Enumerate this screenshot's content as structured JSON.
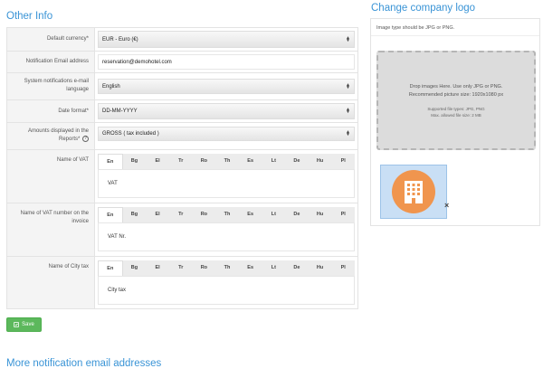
{
  "other_info": {
    "title": "Other Info",
    "default_currency": {
      "label": "Default currency*",
      "value": "EUR - Euro (€)"
    },
    "notification_email": {
      "label": "Notification Email address",
      "value": "reservation@demohotel.com"
    },
    "system_language": {
      "label": "System notifications e-mail language",
      "value": "English"
    },
    "date_format": {
      "label": "Date format*",
      "value": "DD-MM-YYYY"
    },
    "amounts_displayed": {
      "label": "Amounts displayed in the Reports*",
      "help": "?",
      "value": "GROSS ( tax included )"
    },
    "language_tabs": [
      "En",
      "Bg",
      "El",
      "Tr",
      "Ro",
      "Th",
      "Es",
      "Lt",
      "De",
      "Hu",
      "Pl"
    ],
    "vat_name": {
      "label": "Name of VAT",
      "value": "VAT"
    },
    "vat_number_name": {
      "label": "Name of VAT number on the invoice",
      "value": "VAT Nr."
    },
    "city_tax_name": {
      "label": "Name of City tax",
      "value": "City tax"
    },
    "save_label": "Save"
  },
  "company_logo": {
    "title": "Change company logo",
    "hint": "Image type should be JPG or PNG.",
    "dropzone": {
      "main_line1": "Drop images Here. Use only JPG or PNG.",
      "main_line2": "Recommended picture size: 1920x1080 px",
      "small_line1": "Supported file types: JPG, PNG",
      "small_line2": "Max. allowed file size: 2 MB"
    },
    "remove_symbol": "×"
  },
  "more_notifications": {
    "title": "More notification email addresses"
  },
  "colors": {
    "accent": "#3a94d6",
    "save_button": "#5cb85c",
    "logo_orange": "#f0954e"
  },
  "icons": {
    "save": "save-icon",
    "building": "building-icon",
    "caret": "select-caret-icon",
    "help": "help-icon"
  }
}
